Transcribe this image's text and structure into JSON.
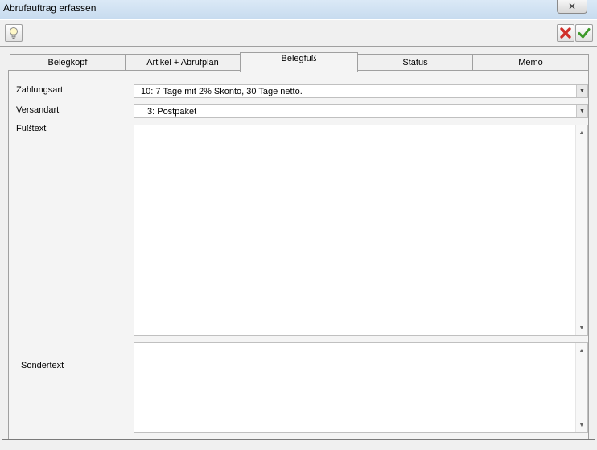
{
  "window": {
    "title": "Abrufauftrag erfassen",
    "close_glyph": "✕"
  },
  "toolbar": {
    "help_icon": "lightbulb-icon",
    "cancel_icon": "red-x-icon",
    "ok_icon": "green-check-icon"
  },
  "tabs": [
    {
      "label": "Belegkopf"
    },
    {
      "label": "Artikel + Abrufplan"
    },
    {
      "label": "Belegfuß",
      "active": true
    },
    {
      "label": "Status"
    },
    {
      "label": "Memo"
    }
  ],
  "form": {
    "zahlungsart_label": "Zahlungsart",
    "zahlungsart_value": "10: 7 Tage mit 2% Skonto, 30 Tage netto.",
    "versandart_label": "Versandart",
    "versandart_value": "3: Postpaket",
    "fusstext_label": "Fußtext",
    "fusstext_value": "",
    "sondertext_label": "Sondertext",
    "sondertext_value": ""
  },
  "colors": {
    "cancel": "#d0302a",
    "ok": "#3d9a2b",
    "border": "#a0a0a0"
  }
}
